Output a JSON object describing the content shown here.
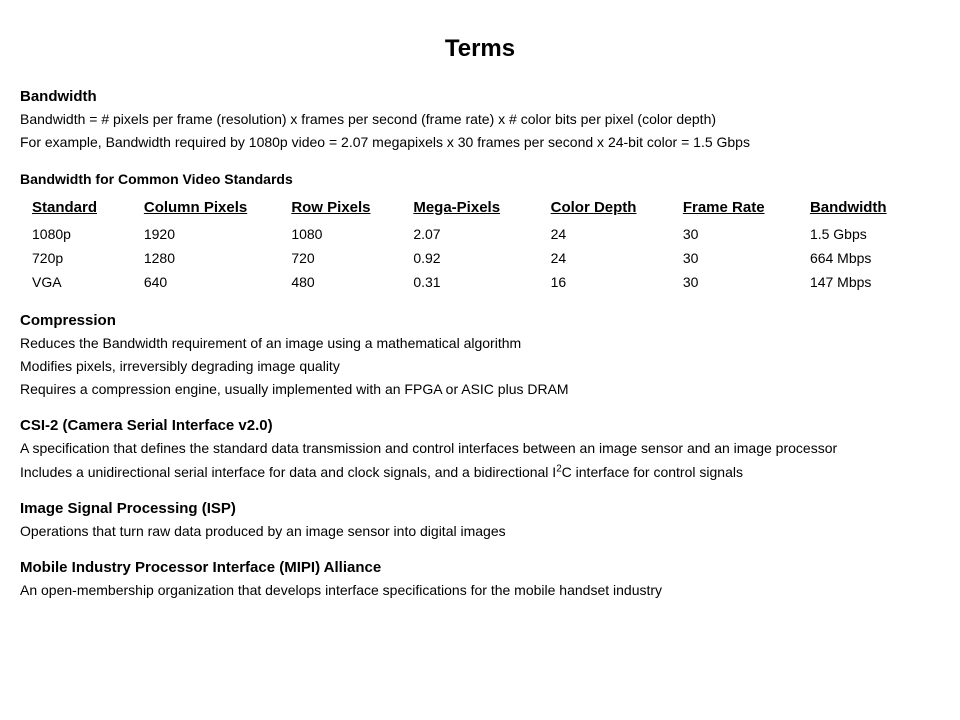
{
  "title": "Terms",
  "bandwidth": {
    "heading": "Bandwidth",
    "line1": "Bandwidth = # pixels per frame (resolution) x frames per second (frame rate) x # color bits per pixel (color depth)",
    "line2": "For example, Bandwidth required by 1080p video = 2.07 megapixels x 30 frames per second x 24-bit color = 1.5 Gbps"
  },
  "table": {
    "heading": "Bandwidth for Common Video Standards",
    "headers": [
      "Standard",
      "Column Pixels",
      "Row Pixels",
      "Mega-Pixels",
      "Color Depth",
      "Frame Rate",
      "Bandwidth"
    ],
    "rows": [
      [
        "1080p",
        "1920",
        "1080",
        "2.07",
        "24",
        "30",
        "1.5 Gbps"
      ],
      [
        "720p",
        "1280",
        "720",
        "0.92",
        "24",
        "30",
        "664 Mbps"
      ],
      [
        "VGA",
        "640",
        "480",
        "0.31",
        "16",
        "30",
        "147 Mbps"
      ]
    ]
  },
  "compression": {
    "heading": "Compression",
    "line1": "Reduces the Bandwidth requirement of an image using a mathematical algorithm",
    "line2": "Modifies pixels, irreversibly degrading image quality",
    "line3": "Requires a compression engine, usually implemented with an FPGA or ASIC plus DRAM"
  },
  "csi2": {
    "heading": "CSI-2 (Camera Serial Interface v2.0)",
    "line1": "A specification that defines the standard data transmission and control interfaces between an image sensor and an image processor",
    "line2_pre": "Includes a unidirectional serial interface for data and clock signals, and a bidirectional I",
    "line2_sup": "2",
    "line2_post": "C interface for control signals"
  },
  "isp": {
    "heading": "Image Signal Processing (ISP)",
    "line1": "Operations that turn raw data produced by an image sensor into digital images"
  },
  "mipi": {
    "heading": "Mobile Industry Processor Interface (MIPI) Alliance",
    "line1": "An open-membership organization that develops interface specifications for the mobile handset industry"
  }
}
